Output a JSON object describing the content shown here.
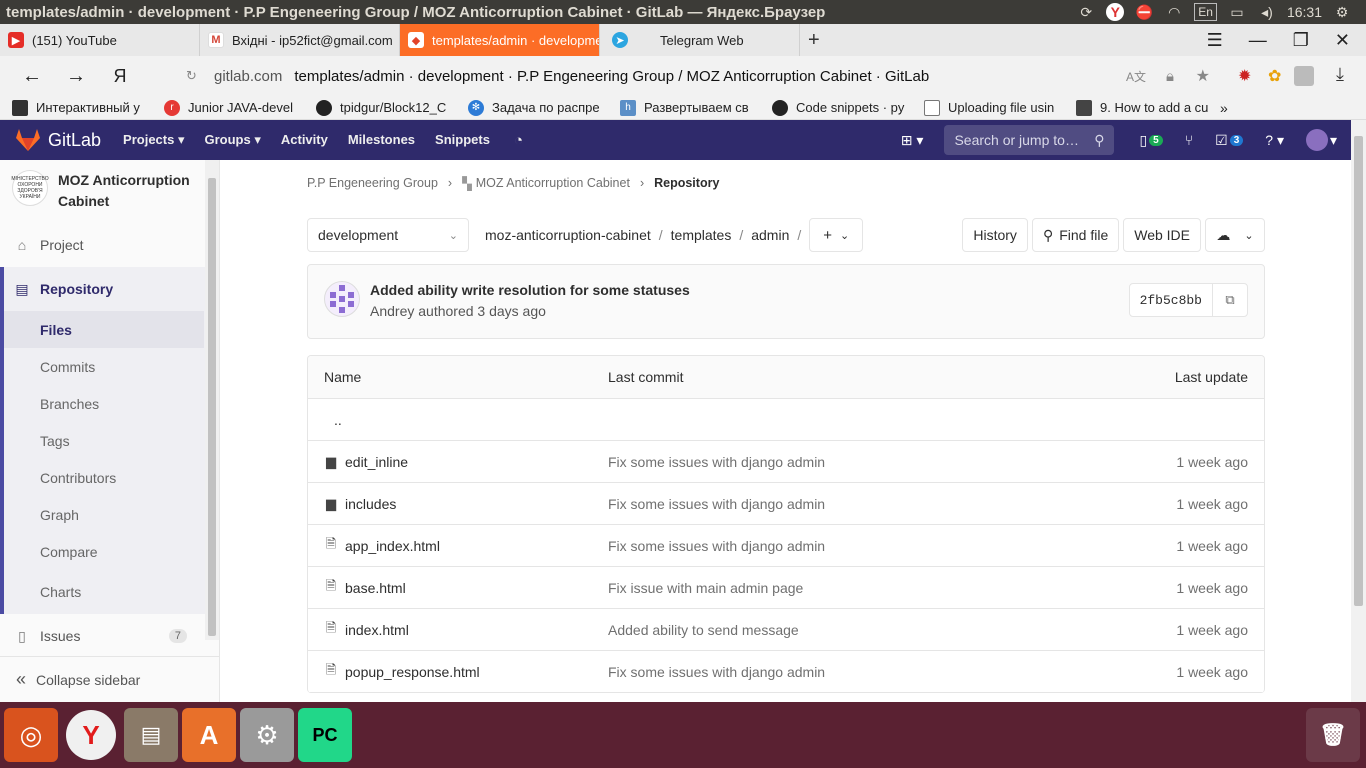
{
  "os": {
    "window_title": "templates/admin · development · P.P Engeneering Group / MOZ Anticorruption Cabinet · GitLab — Яндекс.Браузер",
    "lang": "En",
    "clock": "16:31"
  },
  "browser": {
    "tabs": [
      {
        "label": "(151) YouTube",
        "icon": "youtube-icon",
        "color": "#e52d27",
        "glyph": "▶"
      },
      {
        "label": "Вхідні - ip52fict@gmail.com",
        "icon": "gmail-icon",
        "color": "#d44638",
        "glyph": "M"
      },
      {
        "label": "templates/admin · development",
        "icon": "gitlab-icon",
        "color": "#e24329",
        "glyph": "◆"
      },
      {
        "label": "Telegram Web",
        "icon": "telegram-icon",
        "color": "#2ca5e0",
        "glyph": "➤"
      }
    ],
    "url_host": "gitlab.com",
    "url_title": "templates/admin · development · P.P Engeneering Group / MOZ Anticorruption Cabinet · GitLab",
    "bookmarks": [
      {
        "label": "Интерактивный у",
        "color": "#333",
        "glyph": "▮"
      },
      {
        "label": "Junior JAVA-devel",
        "color": "#e53935",
        "glyph": "r"
      },
      {
        "label": "tpidgur/Block12_C",
        "color": "#222",
        "glyph": "●"
      },
      {
        "label": "Задача по распре",
        "color": "#2d7bd6",
        "glyph": "✻"
      },
      {
        "label": "Развертываем св",
        "color": "#5b8fc7",
        "glyph": "h"
      },
      {
        "label": "Code snippets · py",
        "color": "#222",
        "glyph": "●"
      },
      {
        "label": "Uploading file usin",
        "color": "#999",
        "glyph": "□"
      },
      {
        "label": "9. How to add a cu",
        "color": "#444",
        "glyph": "▦"
      }
    ]
  },
  "gitlab": {
    "brand": "GitLab",
    "menu": [
      "Projects",
      "Groups",
      "Activity",
      "Milestones",
      "Snippets"
    ],
    "search_placeholder": "Search or jump to…",
    "issues_count": "5",
    "todos_count": "3"
  },
  "sidebar": {
    "project_name": "MOZ Anticorruption Cabinet",
    "project_logo_text": "МІНІСТЕРСТВО ОХОРОНИ ЗДОРОВ'Я УКРАЇНИ",
    "project": "Project",
    "repository": "Repository",
    "sub_items": [
      "Files",
      "Commits",
      "Branches",
      "Tags",
      "Contributors",
      "Graph",
      "Compare",
      "Charts"
    ],
    "issues": "Issues",
    "issues_count": "7",
    "collapse": "Collapse sidebar"
  },
  "breadcrumb": {
    "group": "P.P Engeneering Group",
    "project": "MOZ Anticorruption Cabinet",
    "current": "Repository"
  },
  "tree": {
    "branch": "development",
    "path": [
      "moz-anticorruption-cabinet",
      "templates",
      "admin"
    ],
    "history": "History",
    "find_file": "Find file",
    "web_ide": "Web IDE"
  },
  "commit": {
    "message": "Added ability write resolution for some statuses",
    "meta": "Andrey authored 3 days ago",
    "sha": "2fb5c8bb"
  },
  "files": {
    "headers": {
      "name": "Name",
      "last_commit": "Last commit",
      "last_update": "Last update"
    },
    "parent": "..",
    "rows": [
      {
        "type": "folder",
        "name": "edit_inline",
        "commit": "Fix some issues with django admin",
        "updated": "1 week ago"
      },
      {
        "type": "folder",
        "name": "includes",
        "commit": "Fix some issues with django admin",
        "updated": "1 week ago"
      },
      {
        "type": "file",
        "name": "app_index.html",
        "commit": "Fix some issues with django admin",
        "updated": "1 week ago"
      },
      {
        "type": "file",
        "name": "base.html",
        "commit": "Fix issue with main admin page",
        "updated": "1 week ago"
      },
      {
        "type": "file",
        "name": "index.html",
        "commit": "Added ability to send message",
        "updated": "1 week ago"
      },
      {
        "type": "file",
        "name": "popup_response.html",
        "commit": "Fix some issues with django admin",
        "updated": "1 week ago"
      }
    ]
  },
  "dock": [
    {
      "name": "ubuntu-icon",
      "color": "#d9531e",
      "glyph": "◎"
    },
    {
      "name": "yandex-browser-icon",
      "color": "#e8e8e8",
      "glyph": "Y"
    },
    {
      "name": "files-icon",
      "color": "#7a6a5a",
      "glyph": "▤"
    },
    {
      "name": "software-center-icon",
      "color": "#e8702a",
      "glyph": "A"
    },
    {
      "name": "settings-icon",
      "color": "#8a8a8a",
      "glyph": "⚙"
    },
    {
      "name": "pycharm-icon",
      "color": "#2fb36e",
      "glyph": "PC"
    }
  ]
}
